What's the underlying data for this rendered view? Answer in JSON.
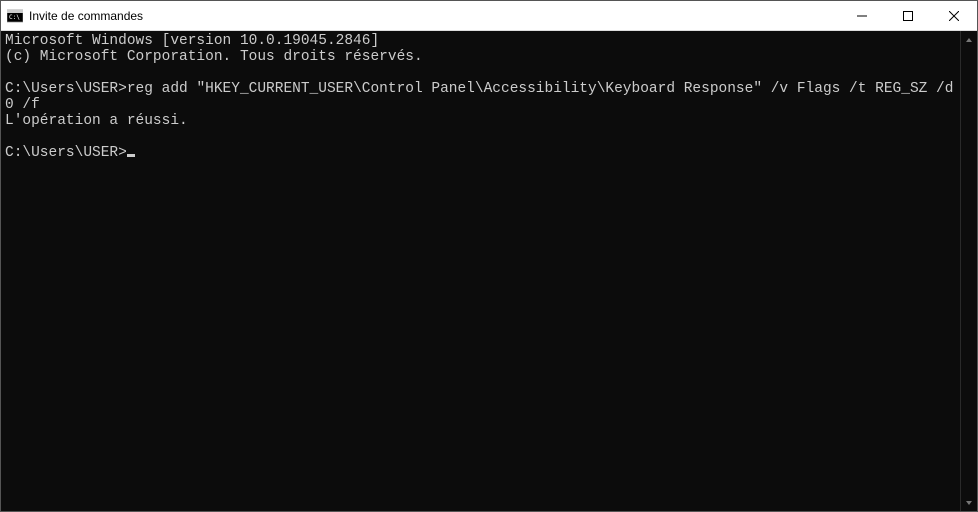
{
  "window": {
    "title": "Invite de commandes"
  },
  "terminal": {
    "line1": "Microsoft Windows [version 10.0.19045.2846]",
    "line2": "(c) Microsoft Corporation. Tous droits réservés.",
    "blank1": "",
    "prompt1": "C:\\Users\\USER>",
    "command1": "reg add \"HKEY_CURRENT_USER\\Control Panel\\Accessibility\\Keyboard Response\" /v Flags /t REG_SZ /d 0 /f",
    "result1": "L'opération a réussi.",
    "blank2": "",
    "prompt2": "C:\\Users\\USER>"
  }
}
